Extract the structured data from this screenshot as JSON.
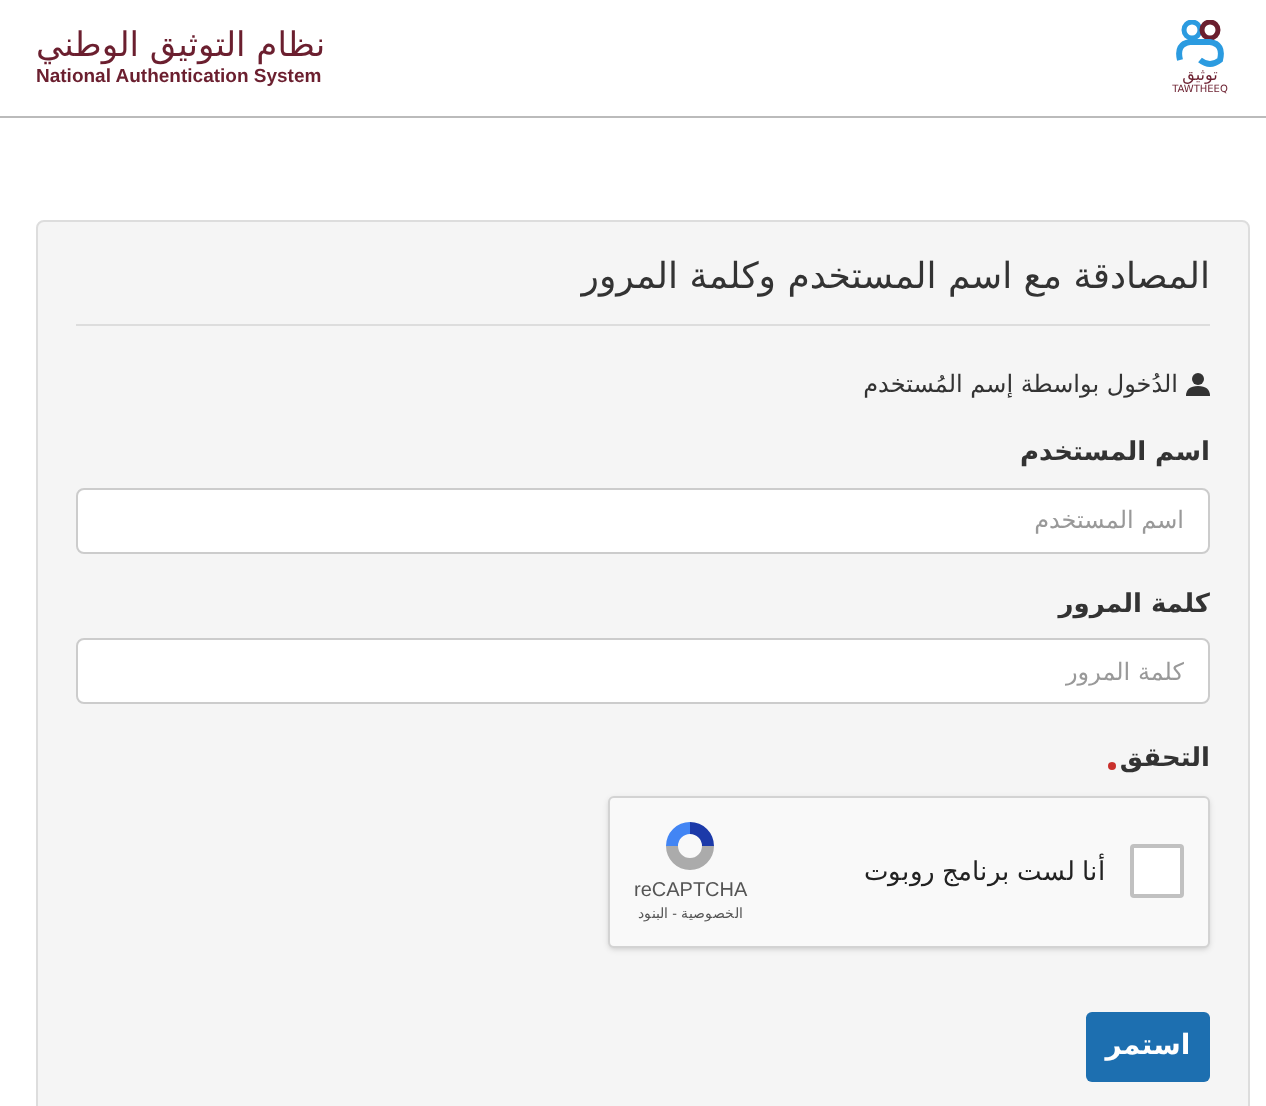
{
  "header": {
    "title_ar": "نظام التوثيق الوطني",
    "title_en": "National Authentication System",
    "logo": {
      "arabic": "توثيق",
      "latin": "TAWTHEEQ"
    }
  },
  "card": {
    "title": "المصادقة مع اسم المستخدم وكلمة المرور",
    "subheading": "الدُخول بواسطة إسم المُستخدم",
    "fields": [
      {
        "label": "اسم المستخدم",
        "placeholder": "اسم المستخدم"
      },
      {
        "label": "كلمة المرور",
        "placeholder": "كلمة المرور"
      }
    ],
    "verification": {
      "label": "التحقق",
      "required": true,
      "captcha": {
        "text": "أنا لست برنامج روبوت",
        "checked": false,
        "brand": "reCAPTCHA",
        "links": "الخصوصية - البنود"
      }
    },
    "submit": "استمر"
  }
}
